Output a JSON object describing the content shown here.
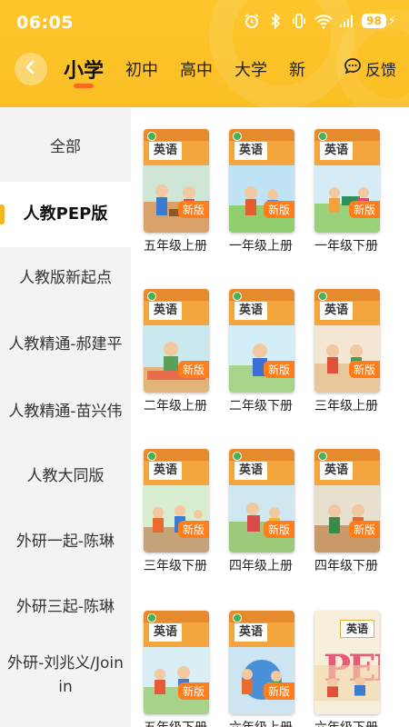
{
  "status": {
    "time": "06:05",
    "battery": "98"
  },
  "nav": {
    "tabs": [
      "小学",
      "初中",
      "高中",
      "大学",
      "新"
    ],
    "active_tab": 0,
    "feedback_label": "反馈"
  },
  "sidebar": {
    "items": [
      {
        "label": "全部"
      },
      {
        "label": "人教PEP版"
      },
      {
        "label": "人教版新起点"
      },
      {
        "label": "人教精通-郝建平"
      },
      {
        "label": "人教精通-苗兴伟"
      },
      {
        "label": "人教大同版"
      },
      {
        "label": "外研一起-陈琳"
      },
      {
        "label": "外研三起-陈琳"
      },
      {
        "label": "外研-刘兆义/Join in"
      }
    ],
    "active_index": 1
  },
  "books": [
    {
      "title": "五年级上册",
      "cover_title": "英语",
      "badge": "新版"
    },
    {
      "title": "一年级上册",
      "cover_title": "英语",
      "badge": "新版"
    },
    {
      "title": "一年级下册",
      "cover_title": "英语",
      "badge": "新版"
    },
    {
      "title": "二年级上册",
      "cover_title": "英语",
      "badge": "新版"
    },
    {
      "title": "二年级下册",
      "cover_title": "英语",
      "badge": "新版"
    },
    {
      "title": "三年级上册",
      "cover_title": "英语",
      "badge": "新版"
    },
    {
      "title": "三年级下册",
      "cover_title": "英语",
      "badge": "新版"
    },
    {
      "title": "四年级上册",
      "cover_title": "英语",
      "badge": "新版"
    },
    {
      "title": "四年级下册",
      "cover_title": "英语",
      "badge": "新版"
    },
    {
      "title": "五年级下册",
      "cover_title": "英语",
      "badge": "新版"
    },
    {
      "title": "六年级上册",
      "cover_title": "英语",
      "badge": "新版"
    },
    {
      "title": "六年级下册",
      "cover_title": "英语",
      "badge": ""
    }
  ],
  "colors": {
    "header": "#fbbf24",
    "accent": "#ff6a1a",
    "badge": "#ff7d1a",
    "sidebar_bg": "#f3f3f3"
  },
  "icons": [
    "back-icon",
    "feedback-icon",
    "alarm-icon",
    "bluetooth-icon",
    "vibrate-icon",
    "wifi-icon",
    "signal-icon",
    "battery-icon"
  ]
}
